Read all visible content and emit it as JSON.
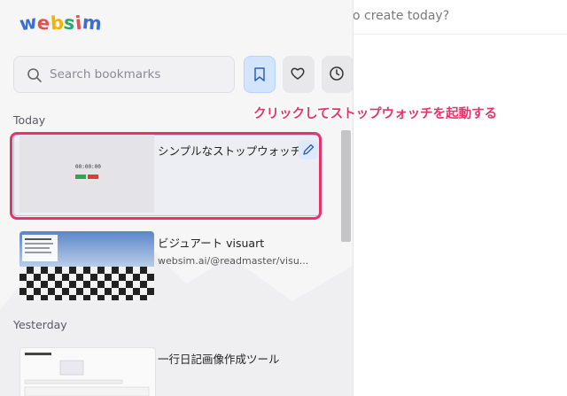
{
  "logo": {
    "letters": [
      "w",
      "e",
      "b",
      "s",
      "i",
      "m"
    ],
    "colors": [
      "#3b6fd6",
      "#e94d4d",
      "#f0b400",
      "#2aa86b",
      "#e94d4d",
      "#3b6fd6"
    ]
  },
  "search": {
    "placeholder": "Search bookmarks",
    "value": ""
  },
  "toolbar": {
    "bookmarks_icon": "bookmark-icon",
    "favorites_icon": "heart-icon",
    "history_icon": "clock-icon"
  },
  "main": {
    "prompt_text": "o create today?"
  },
  "sections": {
    "today": "Today",
    "yesterday": "Yesterday"
  },
  "items": [
    {
      "title": "シンプルなストップウォッチ",
      "url": "",
      "thumb_text": "00:00:00"
    },
    {
      "title": "ビジュアート visuart",
      "url": "websim.ai/@readmaster/visu...",
      "thumb_text": "ビジュアート"
    },
    {
      "title": "一行日記画像作成ツール",
      "url": "",
      "thumb_text": "画像生成ツール"
    }
  ],
  "annotation": {
    "text": "クリックしてストップウォッチを起動する",
    "color": "#e8336a"
  },
  "colors": {
    "accent": "#3b6fd6",
    "highlight": "#e8336a",
    "panel_bg": "#f6f6f7"
  }
}
